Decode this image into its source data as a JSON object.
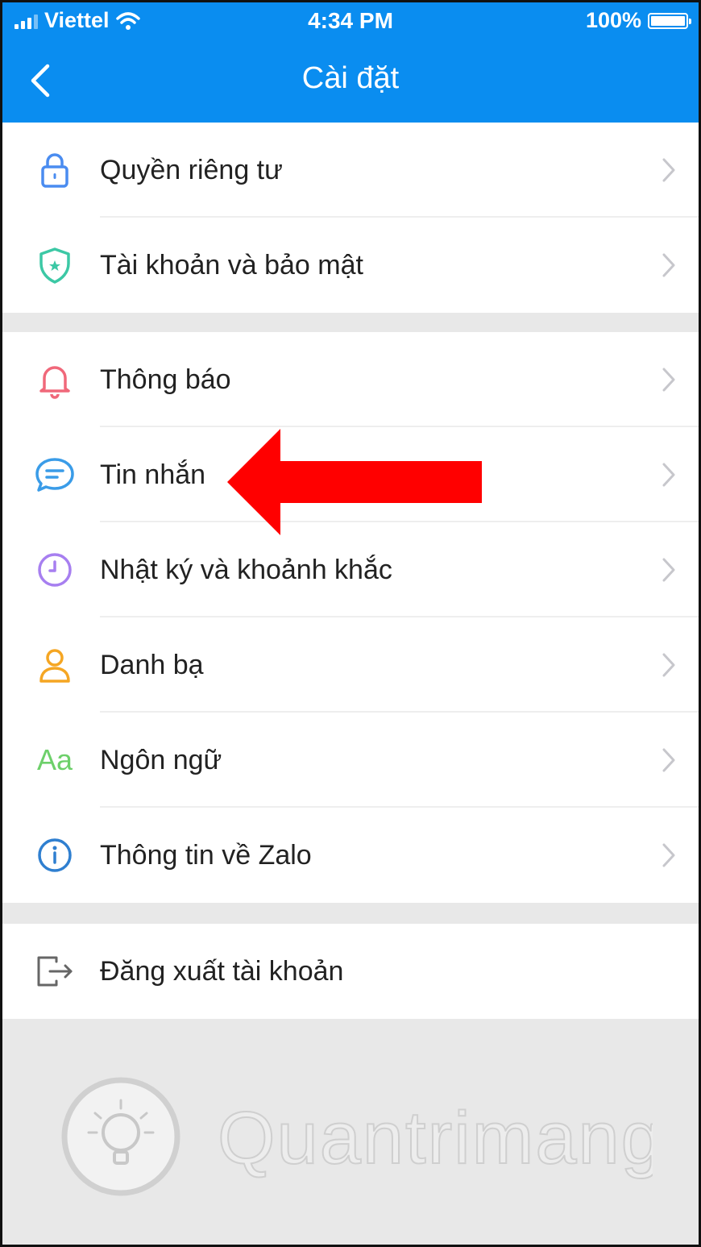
{
  "status_bar": {
    "carrier": "Viettel",
    "time": "4:34 PM",
    "battery": "100%"
  },
  "header": {
    "title": "Cài đặt"
  },
  "group1": [
    {
      "label": "Quyền riêng tư",
      "icon": "lock-icon"
    },
    {
      "label": "Tài khoản và bảo mật",
      "icon": "shield-icon"
    }
  ],
  "group2": [
    {
      "label": "Thông báo",
      "icon": "bell-icon"
    },
    {
      "label": "Tin nhắn",
      "icon": "chat-bubble-icon"
    },
    {
      "label": "Nhật ký và khoảnh khắc",
      "icon": "clock-icon"
    },
    {
      "label": "Danh bạ",
      "icon": "person-icon"
    },
    {
      "label": "Ngôn ngữ",
      "icon": "language-icon",
      "icon_text": "Aa"
    },
    {
      "label": "Thông tin về Zalo",
      "icon": "info-icon"
    }
  ],
  "group3": [
    {
      "label": "Đăng xuất tài khoản",
      "icon": "logout-icon"
    }
  ],
  "watermark": {
    "text": "Quantrimang"
  },
  "colors": {
    "header": "#0a8df0",
    "arrow": "#ff0000",
    "lock": "#4a8cf0",
    "shield": "#3cc8a5",
    "bell": "#f0687a",
    "chat": "#3a9ce8",
    "clock": "#a77ff0",
    "person": "#f5a623",
    "language": "#6dd06a",
    "info": "#2f7fd0",
    "logout": "#666666"
  }
}
